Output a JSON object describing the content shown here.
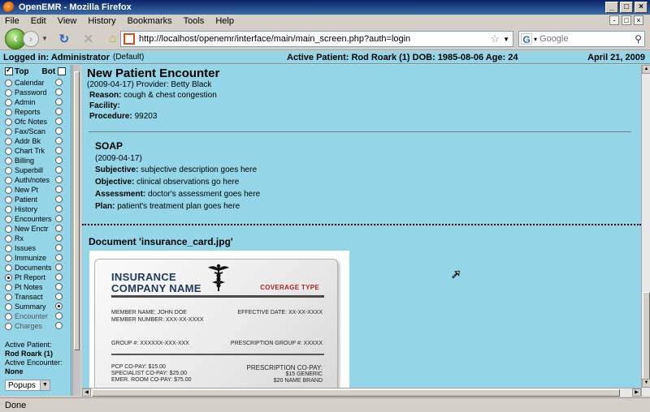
{
  "window": {
    "title": "OpenEMR - Mozilla Firefox"
  },
  "menu": {
    "items": [
      "File",
      "Edit",
      "View",
      "History",
      "Bookmarks",
      "Tools",
      "Help"
    ]
  },
  "nav": {
    "url": "http://localhost/openemr/interface/main/main_screen.php?auth=login",
    "search_placeholder": "Google",
    "search_engine_letter": "G"
  },
  "header": {
    "logged_in": "Logged in: Administrator",
    "logged_in_suffix": "(Default)",
    "active_patient": "Active Patient: Rod Roark (1) DOB: 1985-08-06 Age: 24",
    "date": "April 21, 2009"
  },
  "sidebar": {
    "top_label": "Top",
    "bot_label": "Bot",
    "items": [
      {
        "label": "Calendar"
      },
      {
        "label": "Password"
      },
      {
        "label": "Admin"
      },
      {
        "label": "Reports"
      },
      {
        "label": "Ofc Notes"
      },
      {
        "label": "Fax/Scan"
      },
      {
        "label": "Addr Bk"
      },
      {
        "label": "Chart Trk"
      },
      {
        "label": "Billing"
      },
      {
        "label": "Superbill"
      },
      {
        "label": "Auth/notes"
      },
      {
        "label": "New Pt"
      },
      {
        "label": "Patient"
      },
      {
        "label": "History"
      },
      {
        "label": "Encounters"
      },
      {
        "label": "New Enctr"
      },
      {
        "label": "Rx"
      },
      {
        "label": "Issues"
      },
      {
        "label": "Immunize"
      },
      {
        "label": "Documents"
      },
      {
        "label": "Pt Report"
      },
      {
        "label": "Pt Notes"
      },
      {
        "label": "Transact"
      },
      {
        "label": "Summary"
      },
      {
        "label": "Encounter"
      },
      {
        "label": "Charges"
      }
    ],
    "active_patient_label": "Active Patient:",
    "active_patient_name": "Rod Roark (1)",
    "active_encounter_label": "Active Encounter:",
    "active_encounter_value": "None",
    "popups_value": "Popups"
  },
  "encounter": {
    "title": "New Patient Encounter",
    "provider_line": "(2009-04-17) Provider: Betty Black",
    "reason_label": "Reason:",
    "reason_value": "cough & chest congestion",
    "facility_label": "Facility:",
    "procedure_label": "Procedure:",
    "procedure_value": "99203"
  },
  "soap": {
    "title": "SOAP",
    "date": "(2009-04-17)",
    "subjective_label": "Subjective:",
    "subjective_value": "subjective description goes here",
    "objective_label": "Objective:",
    "objective_value": "clinical observations go here",
    "assessment_label": "Assessment:",
    "assessment_value": "doctor's assessment goes here",
    "plan_label": "Plan:",
    "plan_value": "patient's treatment plan goes here"
  },
  "document": {
    "title": "Document 'insurance_card.jpg'",
    "card": {
      "company_line1": "INSURANCE",
      "company_line2": "COMPANY NAME",
      "coverage_type": "COVERAGE TYPE",
      "member_name": "MEMBER NAME:  JOHN DOE",
      "member_number": "MEMBER NUMBER: XXX-XX-XXXX",
      "effective_date": "EFFECTIVE DATE: XX-XX-XXXX",
      "group": "GROUP #:   XXXXXX-XXX-XXX",
      "prescription_group": "PRESCRIPTION GROUP #:   XXXXX",
      "pcp_copay": "PCP CO-PAY: $15.00",
      "specialist_copay": "SPECIALIST CO-PAY: $25.00",
      "er_copay": "EMER. ROOM CO-PAY: $75.00",
      "rx_copay_label": "PRESCRIPTION CO-PAY:",
      "rx_generic": "$15 GENERIC",
      "rx_brand": "$20 NAME BRAND"
    }
  },
  "status": {
    "text": "Done"
  }
}
